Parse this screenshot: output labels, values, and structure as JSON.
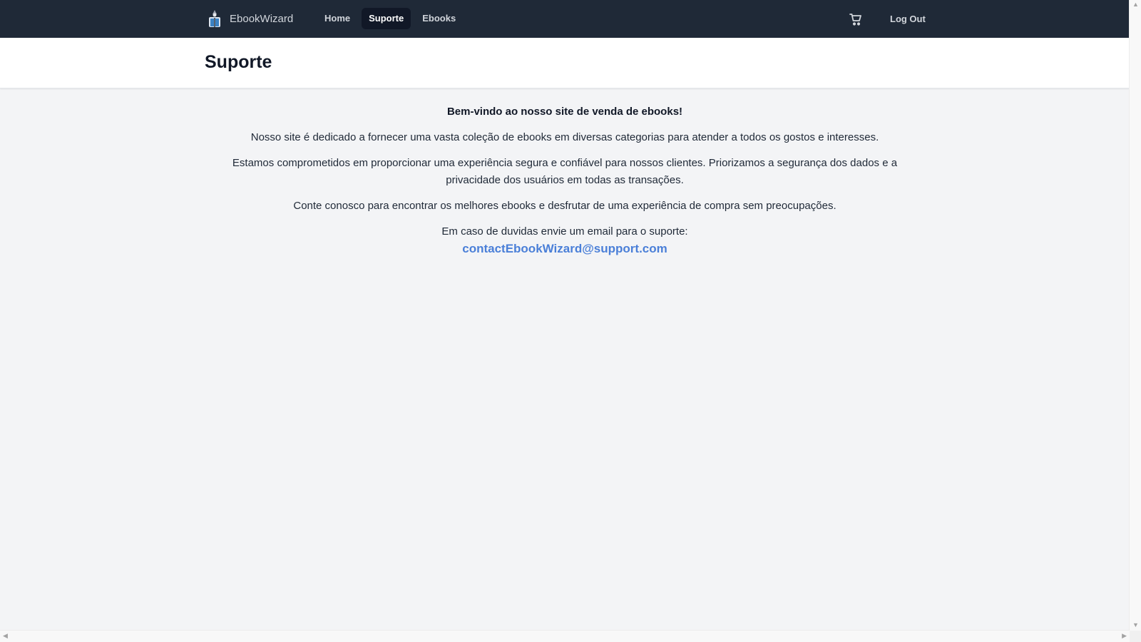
{
  "nav": {
    "brand": "EbookWizard",
    "links": [
      {
        "label": "Home"
      },
      {
        "label": "Suporte",
        "active": true
      },
      {
        "label": "Ebooks"
      }
    ],
    "cart_icon": "cart-icon",
    "logout_label": "Log Out"
  },
  "header": {
    "title": "Suporte"
  },
  "main": {
    "welcome": "Bem-vindo ao nosso site de venda de ebooks!",
    "paragraph1": "Nosso site é dedicado a fornecer uma vasta coleção de ebooks em diversas categorias para atender a todos os gostos e interesses.",
    "paragraph2": "Estamos comprometidos em proporcionar uma experiência segura e confiável para nossos clientes. Priorizamos a segurança dos dados e a privacidade dos usuários em todas as transações.",
    "paragraph3": "Conte conosco para encontrar os melhores ebooks e desfrutar de uma experiência de compra sem preocupações.",
    "contact_text": "Em caso de duvidas envie um email para o suporte:",
    "contact_email": "contactEbookWizard@support.com"
  },
  "colors": {
    "navbar_bg": "#1f2937",
    "active_link_bg": "#111827",
    "page_bg": "#f3f4f6",
    "email_link": "#4a7fd8"
  }
}
